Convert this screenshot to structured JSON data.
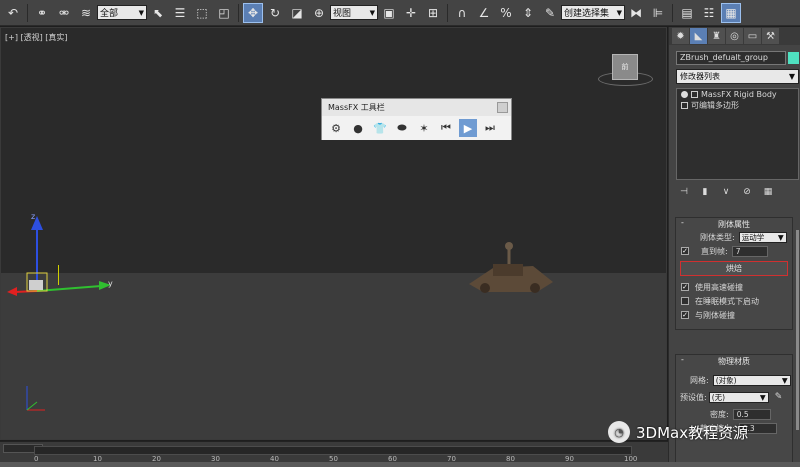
{
  "toolbar": {
    "selection_filter": "全部",
    "ref_coord": "视图",
    "named_selection": "创建选择集"
  },
  "viewport": {
    "label": "[+] [透视] [真实]",
    "viewcube_label": "前",
    "axis_x": "x",
    "axis_y": "y",
    "axis_z": "z"
  },
  "massfx": {
    "title": "MassFX 工具栏"
  },
  "command_panel": {
    "object_name": "ZBrush_defualt_group",
    "object_color": "#4fe0c0",
    "modifier_list": "修改器列表",
    "stack": [
      {
        "label": "MassFX Rigid Body"
      },
      {
        "label": "可编辑多边形"
      }
    ],
    "rigid_rollout": {
      "title": "刚体属性",
      "type_label": "刚体类型:",
      "type_value": "运动学",
      "until_frame_label": "直到帧:",
      "until_frame_value": "7",
      "bake_label": "烘焙",
      "use_hi_speed": "使用高速碰撞",
      "start_in_sleep": "在睡眠模式下启动",
      "collide_with_rigid": "与刚体碰撞"
    },
    "material_rollout": {
      "title": "物理材质",
      "mesh_label": "网格:",
      "mesh_value": "(对象)",
      "preset_label": "预设值:",
      "preset_value": "(无)",
      "density_label": "密度:",
      "density_value": "0.5",
      "static_friction_label": "静摩擦力:",
      "static_friction_value": "0.3"
    }
  },
  "timeline": {
    "current_frame": "0 / 100",
    "ticks": [
      "0",
      "10",
      "20",
      "30",
      "40",
      "50",
      "60",
      "70",
      "80",
      "90",
      "100"
    ]
  },
  "watermark": {
    "text": "3DMax教程资源"
  }
}
